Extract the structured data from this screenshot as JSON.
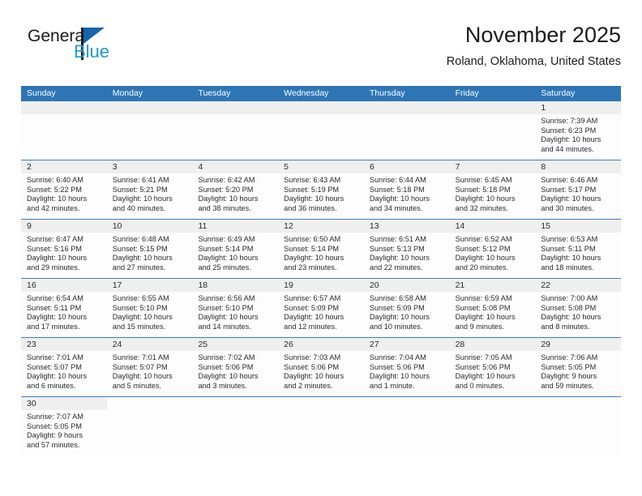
{
  "brand": {
    "name_top": "General",
    "name_bottom": "Blue",
    "accent_color": "#1266ad",
    "accent_color_light": "#2196d6"
  },
  "header": {
    "title": "November 2025",
    "subtitle": "Roland, Oklahoma, United States"
  },
  "theme": {
    "header_blue": "#2e75b6",
    "row_line_blue": "#3f7fbf",
    "daynum_band": "#efefef"
  },
  "weekdays": [
    "Sunday",
    "Monday",
    "Tuesday",
    "Wednesday",
    "Thursday",
    "Friday",
    "Saturday"
  ],
  "weeks": [
    [
      {
        "day": "",
        "empty": true
      },
      {
        "day": "",
        "empty": true
      },
      {
        "day": "",
        "empty": true
      },
      {
        "day": "",
        "empty": true
      },
      {
        "day": "",
        "empty": true
      },
      {
        "day": "",
        "empty": true
      },
      {
        "day": "1",
        "sunrise": "Sunrise: 7:39 AM",
        "sunset": "Sunset: 6:23 PM",
        "daylight1": "Daylight: 10 hours",
        "daylight2": "and 44 minutes."
      }
    ],
    [
      {
        "day": "2",
        "sunrise": "Sunrise: 6:40 AM",
        "sunset": "Sunset: 5:22 PM",
        "daylight1": "Daylight: 10 hours",
        "daylight2": "and 42 minutes."
      },
      {
        "day": "3",
        "sunrise": "Sunrise: 6:41 AM",
        "sunset": "Sunset: 5:21 PM",
        "daylight1": "Daylight: 10 hours",
        "daylight2": "and 40 minutes."
      },
      {
        "day": "4",
        "sunrise": "Sunrise: 6:42 AM",
        "sunset": "Sunset: 5:20 PM",
        "daylight1": "Daylight: 10 hours",
        "daylight2": "and 38 minutes."
      },
      {
        "day": "5",
        "sunrise": "Sunrise: 6:43 AM",
        "sunset": "Sunset: 5:19 PM",
        "daylight1": "Daylight: 10 hours",
        "daylight2": "and 36 minutes."
      },
      {
        "day": "6",
        "sunrise": "Sunrise: 6:44 AM",
        "sunset": "Sunset: 5:18 PM",
        "daylight1": "Daylight: 10 hours",
        "daylight2": "and 34 minutes."
      },
      {
        "day": "7",
        "sunrise": "Sunrise: 6:45 AM",
        "sunset": "Sunset: 5:18 PM",
        "daylight1": "Daylight: 10 hours",
        "daylight2": "and 32 minutes."
      },
      {
        "day": "8",
        "sunrise": "Sunrise: 6:46 AM",
        "sunset": "Sunset: 5:17 PM",
        "daylight1": "Daylight: 10 hours",
        "daylight2": "and 30 minutes."
      }
    ],
    [
      {
        "day": "9",
        "sunrise": "Sunrise: 6:47 AM",
        "sunset": "Sunset: 5:16 PM",
        "daylight1": "Daylight: 10 hours",
        "daylight2": "and 29 minutes."
      },
      {
        "day": "10",
        "sunrise": "Sunrise: 6:48 AM",
        "sunset": "Sunset: 5:15 PM",
        "daylight1": "Daylight: 10 hours",
        "daylight2": "and 27 minutes."
      },
      {
        "day": "11",
        "sunrise": "Sunrise: 6:49 AM",
        "sunset": "Sunset: 5:14 PM",
        "daylight1": "Daylight: 10 hours",
        "daylight2": "and 25 minutes."
      },
      {
        "day": "12",
        "sunrise": "Sunrise: 6:50 AM",
        "sunset": "Sunset: 5:14 PM",
        "daylight1": "Daylight: 10 hours",
        "daylight2": "and 23 minutes."
      },
      {
        "day": "13",
        "sunrise": "Sunrise: 6:51 AM",
        "sunset": "Sunset: 5:13 PM",
        "daylight1": "Daylight: 10 hours",
        "daylight2": "and 22 minutes."
      },
      {
        "day": "14",
        "sunrise": "Sunrise: 6:52 AM",
        "sunset": "Sunset: 5:12 PM",
        "daylight1": "Daylight: 10 hours",
        "daylight2": "and 20 minutes."
      },
      {
        "day": "15",
        "sunrise": "Sunrise: 6:53 AM",
        "sunset": "Sunset: 5:11 PM",
        "daylight1": "Daylight: 10 hours",
        "daylight2": "and 18 minutes."
      }
    ],
    [
      {
        "day": "16",
        "sunrise": "Sunrise: 6:54 AM",
        "sunset": "Sunset: 5:11 PM",
        "daylight1": "Daylight: 10 hours",
        "daylight2": "and 17 minutes."
      },
      {
        "day": "17",
        "sunrise": "Sunrise: 6:55 AM",
        "sunset": "Sunset: 5:10 PM",
        "daylight1": "Daylight: 10 hours",
        "daylight2": "and 15 minutes."
      },
      {
        "day": "18",
        "sunrise": "Sunrise: 6:56 AM",
        "sunset": "Sunset: 5:10 PM",
        "daylight1": "Daylight: 10 hours",
        "daylight2": "and 14 minutes."
      },
      {
        "day": "19",
        "sunrise": "Sunrise: 6:57 AM",
        "sunset": "Sunset: 5:09 PM",
        "daylight1": "Daylight: 10 hours",
        "daylight2": "and 12 minutes."
      },
      {
        "day": "20",
        "sunrise": "Sunrise: 6:58 AM",
        "sunset": "Sunset: 5:09 PM",
        "daylight1": "Daylight: 10 hours",
        "daylight2": "and 10 minutes."
      },
      {
        "day": "21",
        "sunrise": "Sunrise: 6:59 AM",
        "sunset": "Sunset: 5:08 PM",
        "daylight1": "Daylight: 10 hours",
        "daylight2": "and 9 minutes."
      },
      {
        "day": "22",
        "sunrise": "Sunrise: 7:00 AM",
        "sunset": "Sunset: 5:08 PM",
        "daylight1": "Daylight: 10 hours",
        "daylight2": "and 8 minutes."
      }
    ],
    [
      {
        "day": "23",
        "sunrise": "Sunrise: 7:01 AM",
        "sunset": "Sunset: 5:07 PM",
        "daylight1": "Daylight: 10 hours",
        "daylight2": "and 6 minutes."
      },
      {
        "day": "24",
        "sunrise": "Sunrise: 7:01 AM",
        "sunset": "Sunset: 5:07 PM",
        "daylight1": "Daylight: 10 hours",
        "daylight2": "and 5 minutes."
      },
      {
        "day": "25",
        "sunrise": "Sunrise: 7:02 AM",
        "sunset": "Sunset: 5:06 PM",
        "daylight1": "Daylight: 10 hours",
        "daylight2": "and 3 minutes."
      },
      {
        "day": "26",
        "sunrise": "Sunrise: 7:03 AM",
        "sunset": "Sunset: 5:06 PM",
        "daylight1": "Daylight: 10 hours",
        "daylight2": "and 2 minutes."
      },
      {
        "day": "27",
        "sunrise": "Sunrise: 7:04 AM",
        "sunset": "Sunset: 5:06 PM",
        "daylight1": "Daylight: 10 hours",
        "daylight2": "and 1 minute."
      },
      {
        "day": "28",
        "sunrise": "Sunrise: 7:05 AM",
        "sunset": "Sunset: 5:06 PM",
        "daylight1": "Daylight: 10 hours",
        "daylight2": "and 0 minutes."
      },
      {
        "day": "29",
        "sunrise": "Sunrise: 7:06 AM",
        "sunset": "Sunset: 5:05 PM",
        "daylight1": "Daylight: 9 hours",
        "daylight2": "and 59 minutes."
      }
    ],
    [
      {
        "day": "30",
        "sunrise": "Sunrise: 7:07 AM",
        "sunset": "Sunset: 5:05 PM",
        "daylight1": "Daylight: 9 hours",
        "daylight2": "and 57 minutes."
      },
      {
        "day": "",
        "blank": true
      },
      {
        "day": "",
        "blank": true
      },
      {
        "day": "",
        "blank": true
      },
      {
        "day": "",
        "blank": true
      },
      {
        "day": "",
        "blank": true
      },
      {
        "day": "",
        "blank": true
      }
    ]
  ]
}
